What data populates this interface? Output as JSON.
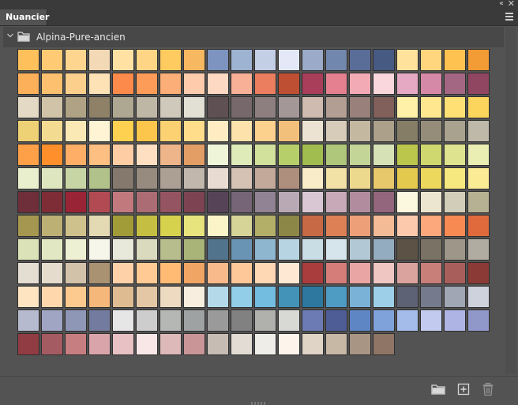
{
  "panel": {
    "tab_label": "Nuancier",
    "group_name": "Alpina-Pure-ancien"
  },
  "icons": {
    "collapse": "double-chevron-left-icon",
    "close": "close-icon",
    "menu": "hamburger-menu-icon",
    "group_toggle": "chevron-down-icon",
    "group_folder": "folder-icon",
    "new_group": "folder-icon",
    "new_swatch": "plus-square-icon",
    "delete": "trash-icon"
  },
  "swatches": [
    [
      "#FEC05A",
      "#FECA74",
      "#FDD58E",
      "#F3D9B5",
      "#FFE1A4",
      "#FED585",
      "#FECB61",
      "#F6B860",
      "#7D93C0",
      "#9EB2D2",
      "#C3CFE5",
      "#E5E9F7",
      "#9BAAC8",
      "#7287AD",
      "#5A6D99",
      "#465A82",
      "#FFE39C",
      "#FFD67E",
      "#FEC250",
      "#F39B35"
    ],
    [
      "#FDB05A",
      "#FCC06F",
      "#FCD08C",
      "#FDE2B6",
      "#FC8A4B",
      "#FD9C59",
      "#FBAE78",
      "#FECCAD",
      "#FDD8C3",
      "#F8B196",
      "#EB7E5E",
      "#BE4F33",
      "#A93E5A",
      "#E4808F",
      "#F2AAB5",
      "#F9D7DD",
      "#E6A9C3",
      "#D689A6",
      "#A46783",
      "#904660"
    ],
    [
      "#E4D9C5",
      "#D1C3A8",
      "#AFA285",
      "#8F8167",
      "#AEA792",
      "#BFB7A6",
      "#CEC9BA",
      "#E2DFD4",
      "#5F5053",
      "#77686B",
      "#8D7F80",
      "#A39797",
      "#D0BBB0",
      "#B29E93",
      "#99807A",
      "#815F5A",
      "#FFF2A8",
      "#FFE78F",
      "#FFE075",
      "#FCD65C"
    ],
    [
      "#EDD174",
      "#F3DC92",
      "#FAE9B5",
      "#FFF4D3",
      "#FED151",
      "#FBC64B",
      "#FCD171",
      "#FFDD8B",
      "#FFECC3",
      "#FEE2AC",
      "#FCD18E",
      "#F3C07C",
      "#EDE3D2",
      "#D6CCB9",
      "#C4B8A1",
      "#ACA08A",
      "#857D66",
      "#958D79",
      "#A9A28F",
      "#BEB9A8"
    ],
    [
      "#FDA048",
      "#FE8F2B",
      "#FEAE66",
      "#FEBF82",
      "#FFCDA4",
      "#FFDFC2",
      "#EFB58A",
      "#E39E66",
      "#EFF5D8",
      "#DFEBB8",
      "#D2E29D",
      "#B6CF6A",
      "#A2BD4F",
      "#AFC77A",
      "#C3D597",
      "#D6E2B6",
      "#BBC64C",
      "#CFD86E",
      "#DEE38F",
      "#EAEEB3"
    ],
    [
      "#E9EECD",
      "#DEE6C0",
      "#C7D5A4",
      "#B1C38A",
      "#85786C",
      "#978A7E",
      "#ABA093",
      "#C1B7AC",
      "#E8DBD1",
      "#D5C2B5",
      "#C2A99A",
      "#AE8E7C",
      "#F8EDC8",
      "#F3E2A6",
      "#EDD98E",
      "#E7C86A",
      "#E3C94E",
      "#EDD85E",
      "#F6E87F",
      "#FCEB95"
    ],
    [
      "#6E2F3A",
      "#7E2D37",
      "#982436",
      "#B24A54",
      "#C1797E",
      "#AB6C73",
      "#955461",
      "#7D4353",
      "#574357",
      "#756577",
      "#928394",
      "#B8A9B5",
      "#D9C8D3",
      "#C7A9B8",
      "#B18C9F",
      "#93667D",
      "#FBF8DF",
      "#ECE5CF",
      "#D1CDB8",
      "#B6B192"
    ],
    [
      "#A59750",
      "#BDB075",
      "#CFC18C",
      "#E3D9B2",
      "#A19C38",
      "#C4BF42",
      "#D7D24E",
      "#E7E47E",
      "#FAF4C8",
      "#D7D497",
      "#B3AF68",
      "#8C8746",
      "#C86945",
      "#DD8056",
      "#EDA078",
      "#F4BB97",
      "#FDC9AC",
      "#FDA77C",
      "#F78953",
      "#E06A3C"
    ],
    [
      "#DBE2B7",
      "#E1E7C2",
      "#EDF0D3",
      "#F6F7EA",
      "#E9E9DB",
      "#D9DABE",
      "#B8BD8E",
      "#A9B578",
      "#52738C",
      "#6994B3",
      "#8FB6CF",
      "#B7D4E2",
      "#C9DDE5",
      "#D6E4EB",
      "#B3C8D5",
      "#93ACBF",
      "#5C5346",
      "#7A7264",
      "#9D9689",
      "#B1ACA1"
    ],
    [
      "#E3DDD2",
      "#E5DCCD",
      "#D2C2AA",
      "#A89272",
      "#FED1A9",
      "#FFCA93",
      "#FFBB74",
      "#F1A564",
      "#F8B98B",
      "#FEC899",
      "#FED7B4",
      "#FFE8D3",
      "#A93C3C",
      "#D47D79",
      "#E8A5A3",
      "#F0C6C2",
      "#DAA39E",
      "#C87E79",
      "#A85F5B",
      "#8B3A35"
    ],
    [
      "#FEE4C1",
      "#FED7AD",
      "#FCC98E",
      "#F6B87A",
      "#DFBB92",
      "#E4C7A4",
      "#EEDAC0",
      "#F7EEDF",
      "#B4DAEA",
      "#92CEE8",
      "#72BDE0",
      "#4393B8",
      "#2E78A0",
      "#4E9BC4",
      "#79B2D6",
      "#9ECFE8",
      "#5D6275",
      "#757B8C",
      "#A0A6B4",
      "#CDD2DD"
    ],
    [
      "#B6BACF",
      "#A0A5C3",
      "#8F97B7",
      "#737C9F",
      "#E6E6E6",
      "#CDCDCD",
      "#B5B7B5",
      "#9FA2A2",
      "#9A9A9A",
      "#818181",
      "#B0B1AD",
      "#D8D9D4",
      "#6C7BB4",
      "#4E5D96",
      "#5E86C4",
      "#7FA2DB",
      "#A4BCE9",
      "#C2CBEF",
      "#AEB5E4",
      "#8F98C9"
    ],
    [
      "#913B43",
      "#A55B62",
      "#C77E81",
      "#D9A5AA",
      "#E8C1C4",
      "#F9E6E7",
      "#DEB9B9",
      "#C99597",
      "#C7BCB3",
      "#E2DCD5",
      "#EFEDE7",
      "#FDF5EB",
      "#E0D4C6",
      "#C7B7A5",
      "#A89584",
      "#8E7565"
    ]
  ]
}
